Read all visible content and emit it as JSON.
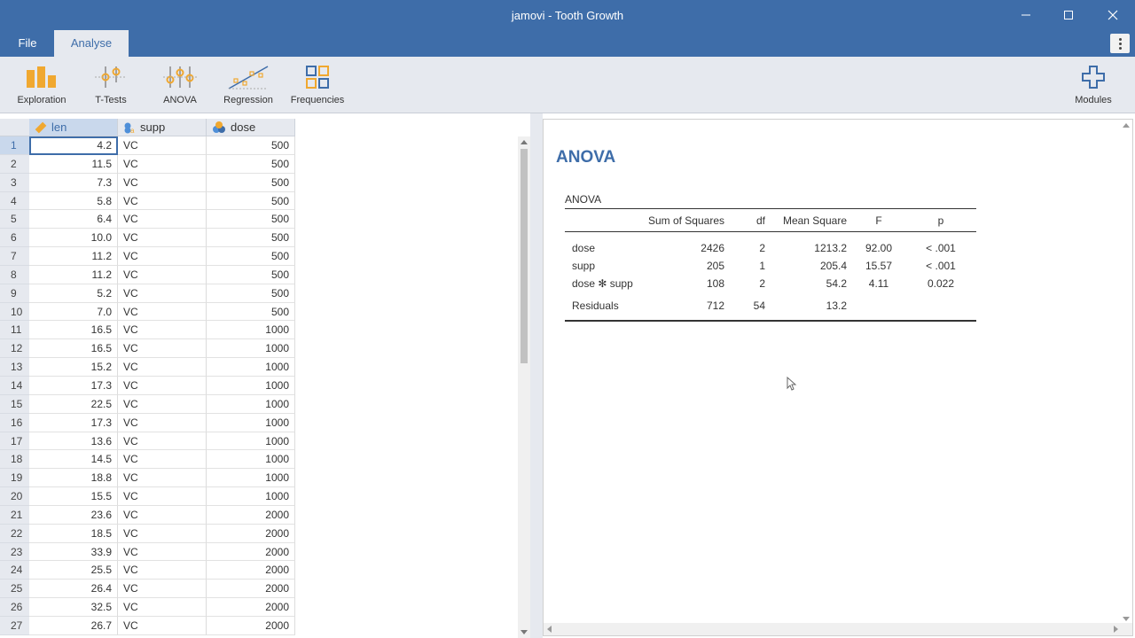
{
  "window": {
    "title": "jamovi - Tooth Growth"
  },
  "menu": {
    "tabs": [
      {
        "label": "File"
      },
      {
        "label": "Analyse"
      }
    ]
  },
  "ribbon": {
    "buttons": [
      {
        "label": "Exploration",
        "icon": "bar-chart-icon"
      },
      {
        "label": "T-Tests",
        "icon": "t-test-icon"
      },
      {
        "label": "ANOVA",
        "icon": "anova-icon"
      },
      {
        "label": "Regression",
        "icon": "regression-icon"
      },
      {
        "label": "Frequencies",
        "icon": "frequencies-icon"
      }
    ],
    "modules_label": "Modules"
  },
  "sheet": {
    "columns": [
      {
        "name": "len",
        "icon": "continuous-ruler-icon"
      },
      {
        "name": "supp",
        "icon": "nominal-text-icon"
      },
      {
        "name": "dose",
        "icon": "nominal-circles-icon"
      }
    ],
    "rows": [
      {
        "n": "1",
        "len": "4.2",
        "supp": "VC",
        "dose": "500"
      },
      {
        "n": "2",
        "len": "11.5",
        "supp": "VC",
        "dose": "500"
      },
      {
        "n": "3",
        "len": "7.3",
        "supp": "VC",
        "dose": "500"
      },
      {
        "n": "4",
        "len": "5.8",
        "supp": "VC",
        "dose": "500"
      },
      {
        "n": "5",
        "len": "6.4",
        "supp": "VC",
        "dose": "500"
      },
      {
        "n": "6",
        "len": "10.0",
        "supp": "VC",
        "dose": "500"
      },
      {
        "n": "7",
        "len": "11.2",
        "supp": "VC",
        "dose": "500"
      },
      {
        "n": "8",
        "len": "11.2",
        "supp": "VC",
        "dose": "500"
      },
      {
        "n": "9",
        "len": "5.2",
        "supp": "VC",
        "dose": "500"
      },
      {
        "n": "10",
        "len": "7.0",
        "supp": "VC",
        "dose": "500"
      },
      {
        "n": "11",
        "len": "16.5",
        "supp": "VC",
        "dose": "1000"
      },
      {
        "n": "12",
        "len": "16.5",
        "supp": "VC",
        "dose": "1000"
      },
      {
        "n": "13",
        "len": "15.2",
        "supp": "VC",
        "dose": "1000"
      },
      {
        "n": "14",
        "len": "17.3",
        "supp": "VC",
        "dose": "1000"
      },
      {
        "n": "15",
        "len": "22.5",
        "supp": "VC",
        "dose": "1000"
      },
      {
        "n": "16",
        "len": "17.3",
        "supp": "VC",
        "dose": "1000"
      },
      {
        "n": "17",
        "len": "13.6",
        "supp": "VC",
        "dose": "1000"
      },
      {
        "n": "18",
        "len": "14.5",
        "supp": "VC",
        "dose": "1000"
      },
      {
        "n": "19",
        "len": "18.8",
        "supp": "VC",
        "dose": "1000"
      },
      {
        "n": "20",
        "len": "15.5",
        "supp": "VC",
        "dose": "1000"
      },
      {
        "n": "21",
        "len": "23.6",
        "supp": "VC",
        "dose": "2000"
      },
      {
        "n": "22",
        "len": "18.5",
        "supp": "VC",
        "dose": "2000"
      },
      {
        "n": "23",
        "len": "33.9",
        "supp": "VC",
        "dose": "2000"
      },
      {
        "n": "24",
        "len": "25.5",
        "supp": "VC",
        "dose": "2000"
      },
      {
        "n": "25",
        "len": "26.4",
        "supp": "VC",
        "dose": "2000"
      },
      {
        "n": "26",
        "len": "32.5",
        "supp": "VC",
        "dose": "2000"
      },
      {
        "n": "27",
        "len": "26.7",
        "supp": "VC",
        "dose": "2000"
      }
    ]
  },
  "results": {
    "heading": "ANOVA",
    "table_title": "ANOVA",
    "headers": [
      "",
      "Sum of Squares",
      "df",
      "Mean Square",
      "F",
      "p"
    ],
    "rows": [
      [
        "dose",
        "2426",
        "2",
        "1213.2",
        "92.00",
        "< .001"
      ],
      [
        "supp",
        "205",
        "1",
        "205.4",
        "15.57",
        "< .001"
      ],
      [
        "dose ✻ supp",
        "108",
        "2",
        "54.2",
        "4.11",
        "0.022"
      ],
      [
        "Residuals",
        "712",
        "54",
        "13.2",
        "",
        ""
      ]
    ]
  },
  "colors": {
    "accent": "#3e6da9",
    "ribbon": "#e6e9ef",
    "icon_orange": "#f0a830"
  }
}
